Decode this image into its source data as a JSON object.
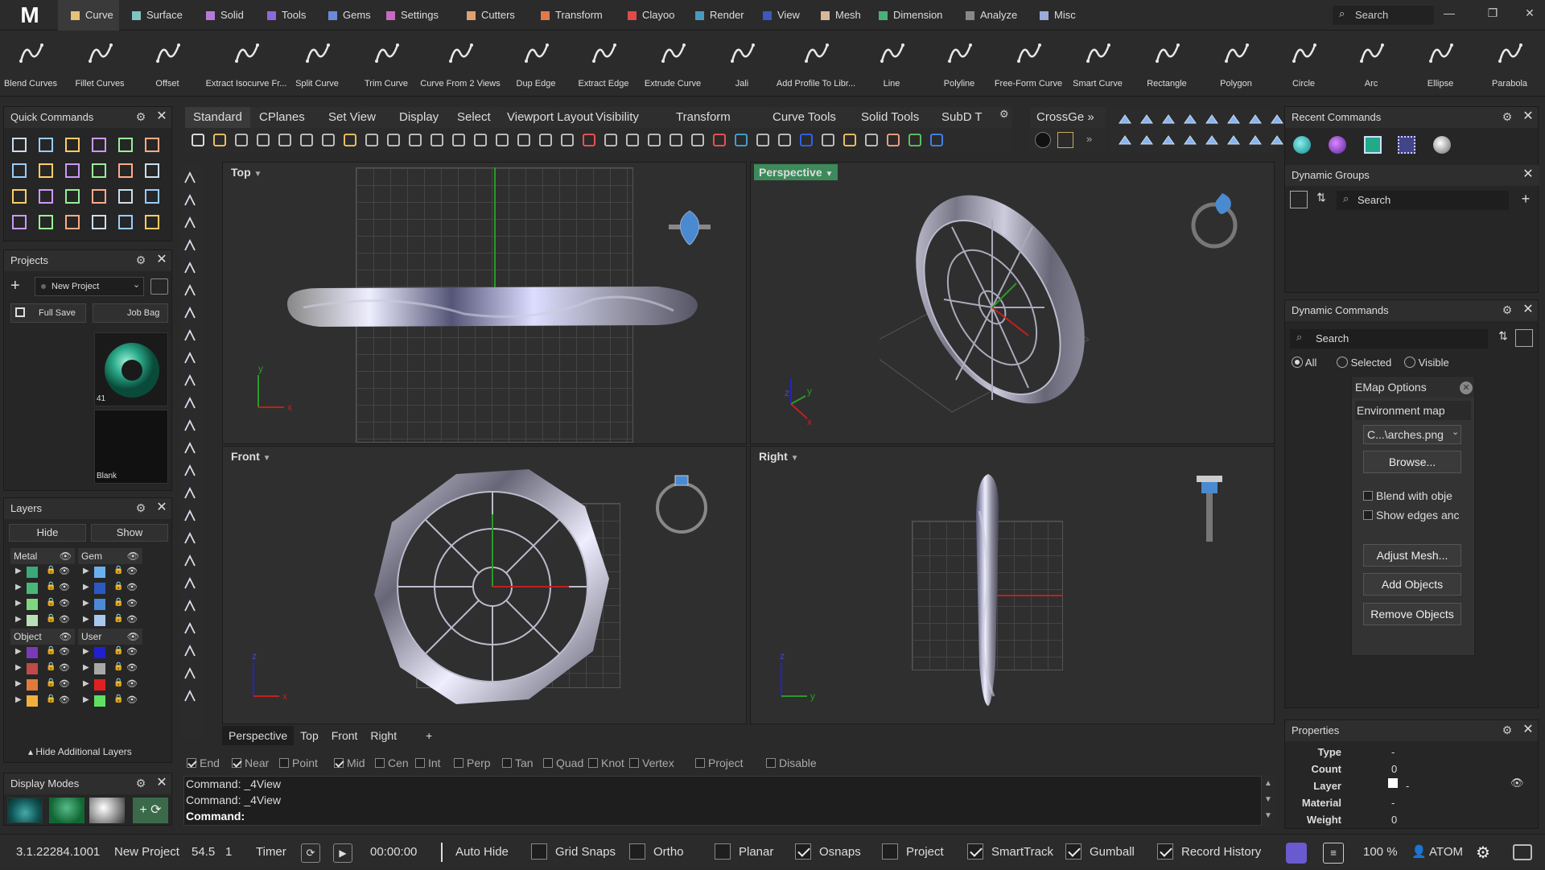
{
  "app": {
    "logo": "M",
    "version": "3.1.22284.1001",
    "project": "New Project"
  },
  "menu_tabs": [
    {
      "label": "Curve",
      "color": "#e6c07a",
      "active": true
    },
    {
      "label": "Surface",
      "color": "#7ec4c4"
    },
    {
      "label": "Solid",
      "color": "#b57ad9"
    },
    {
      "label": "Tools",
      "color": "#8a6ad9"
    },
    {
      "label": "Gems",
      "color": "#6a8ad9"
    },
    {
      "label": "Settings",
      "color": "#c86ac0"
    },
    {
      "label": "Cutters",
      "color": "#e0a070"
    },
    {
      "label": "Transform",
      "color": "#e07a4a"
    },
    {
      "label": "Clayoo",
      "color": "#e04a4a"
    },
    {
      "label": "Render",
      "color": "#4a9ac0"
    },
    {
      "label": "View",
      "color": "#3a5ac0"
    },
    {
      "label": "Mesh",
      "color": "#d9b89a"
    },
    {
      "label": "Dimension",
      "color": "#4ab07a"
    },
    {
      "label": "Analyze",
      "color": "#888888"
    },
    {
      "label": "Misc",
      "color": "#9aaad9"
    }
  ],
  "top_search": {
    "placeholder": "Search"
  },
  "ribbon": [
    "Blend Curves",
    "Fillet Curves",
    "Offset",
    "Extract Isocurve Fr...",
    "Split Curve",
    "Trim Curve",
    "Curve From 2 Views",
    "Dup Edge",
    "Extract Edge",
    "Extrude Curve",
    "Jali",
    "Add Profile To Libr...",
    "Line",
    "Polyline",
    "Free-Form Curve",
    "Smart Curve",
    "Rectangle",
    "Polygon",
    "Circle",
    "Arc",
    "Ellipse",
    "Parabola"
  ],
  "panels": {
    "quick_commands": {
      "title": "Quick Commands"
    },
    "projects": {
      "title": "Projects",
      "new_project": "New Project",
      "full_save": "Full Save",
      "job_bag": "Job Bag",
      "thumb1_label": "41",
      "thumb2_label": "Blank"
    },
    "layers": {
      "title": "Layers",
      "hide": "Hide",
      "show": "Show",
      "groups": [
        "Metal",
        "Gem",
        "Object",
        "User"
      ],
      "metal_colors": [
        "#3aa878",
        "#48b878",
        "#7ed77e",
        "#b8e0b8"
      ],
      "gem_colors": [
        "#6ab0f0",
        "#2a5ac0",
        "#4a8ad9",
        "#a8c8f0"
      ],
      "object_colors": [
        "#7a3ab8",
        "#c04a4a",
        "#e07a3a",
        "#f0b040"
      ],
      "user_colors": [
        "#2020d0",
        "#a8a8a8",
        "#e02020",
        "#60e060"
      ],
      "hide_additional": "Hide Additional Layers"
    },
    "display_modes": {
      "title": "Display Modes"
    }
  },
  "toolbar_tabs": [
    "Standard",
    "CPlanes",
    "Set View",
    "Display",
    "Select",
    "Viewport Layout",
    "Visibility",
    "Transform",
    "Curve Tools",
    "Solid Tools",
    "SubD T"
  ],
  "crossgen": "CrossGe",
  "viewports": {
    "top": "Top",
    "perspective": "Perspective",
    "front": "Front",
    "right": "Right"
  },
  "viewport_tabs": [
    "Perspective",
    "Top",
    "Front",
    "Right"
  ],
  "osnaps": [
    {
      "label": "End",
      "on": true
    },
    {
      "label": "Near",
      "on": true
    },
    {
      "label": "Point",
      "on": false
    },
    {
      "label": "Mid",
      "on": true
    },
    {
      "label": "Cen",
      "on": false
    },
    {
      "label": "Int",
      "on": false
    },
    {
      "label": "Perp",
      "on": false
    },
    {
      "label": "Tan",
      "on": false
    },
    {
      "label": "Quad",
      "on": false
    },
    {
      "label": "Knot",
      "on": false
    },
    {
      "label": "Vertex",
      "on": false
    },
    {
      "label": "Project",
      "on": false
    },
    {
      "label": "Disable",
      "on": false
    }
  ],
  "command": {
    "history": [
      "Command: _4View",
      "Command: _4View"
    ],
    "prompt": "Command:"
  },
  "right": {
    "recent": {
      "title": "Recent Commands"
    },
    "dynamic_groups": {
      "title": "Dynamic Groups",
      "search": "Search"
    },
    "dynamic_commands": {
      "title": "Dynamic Commands",
      "search": "Search",
      "filter": [
        "All",
        "Selected",
        "Visible"
      ]
    },
    "emap": {
      "title": "EMap Options",
      "env_label": "Environment map",
      "env_value": "C...\\arches.png",
      "browse": "Browse...",
      "blend": "Blend with obje",
      "show_edges": "Show edges anc",
      "adjust": "Adjust Mesh...",
      "add": "Add Objects",
      "remove": "Remove Objects"
    },
    "properties": {
      "title": "Properties",
      "rows": [
        {
          "k": "Type",
          "v": "-"
        },
        {
          "k": "Count",
          "v": "0"
        },
        {
          "k": "Layer",
          "v": "-"
        },
        {
          "k": "Material",
          "v": "-"
        },
        {
          "k": "Weight",
          "v": "0"
        }
      ]
    }
  },
  "status": {
    "value1": "54.5",
    "value2": "1",
    "timer": "Timer",
    "time": "00:00:00",
    "auto_hide": "Auto Hide",
    "toggles": [
      {
        "label": "Grid Snaps",
        "on": false
      },
      {
        "label": "Ortho",
        "on": false
      },
      {
        "label": "Planar",
        "on": false
      },
      {
        "label": "Osnaps",
        "on": true
      },
      {
        "label": "Project",
        "on": false
      },
      {
        "label": "SmartTrack",
        "on": true
      },
      {
        "label": "Gumball",
        "on": true
      },
      {
        "label": "Record History",
        "on": true
      }
    ],
    "zoom": "100 %",
    "user": "ATOM"
  }
}
